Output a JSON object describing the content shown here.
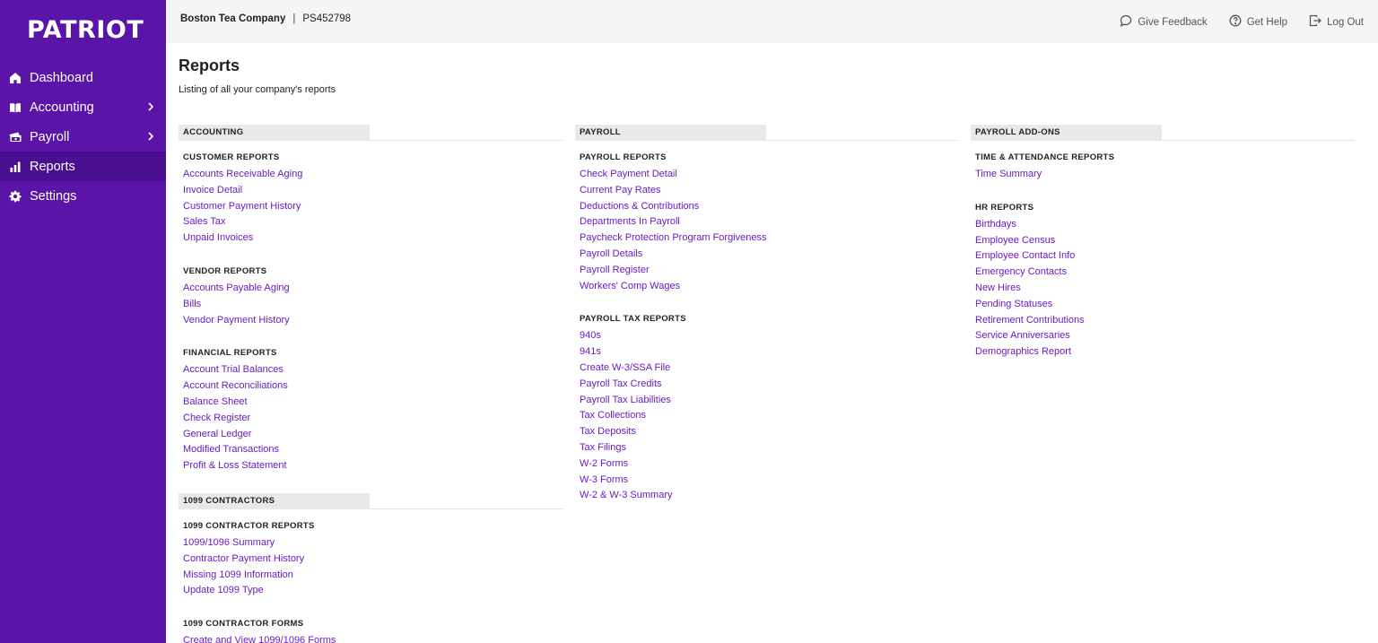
{
  "brand": {
    "logo": "PATRIOT",
    "accent": "#5a14a8",
    "link_color": "#6a1bc2"
  },
  "sidebar": {
    "items": [
      {
        "label": "Dashboard",
        "icon": "home-icon",
        "has_submenu": false,
        "active": false
      },
      {
        "label": "Accounting",
        "icon": "book-icon",
        "has_submenu": true,
        "active": false
      },
      {
        "label": "Payroll",
        "icon": "money-icon",
        "has_submenu": true,
        "active": false
      },
      {
        "label": "Reports",
        "icon": "bar-chart-icon",
        "has_submenu": false,
        "active": true
      },
      {
        "label": "Settings",
        "icon": "gear-icon",
        "has_submenu": false,
        "active": false
      }
    ]
  },
  "header": {
    "company": "Boston Tea Company",
    "separator": "|",
    "account_id": "PS452798",
    "actions": [
      {
        "label": "Give Feedback",
        "icon": "chat-bubble-icon"
      },
      {
        "label": "Get Help",
        "icon": "help-circle-icon"
      },
      {
        "label": "Log Out",
        "icon": "logout-icon"
      }
    ]
  },
  "main": {
    "title": "Reports",
    "subtitle": "Listing of all your company's reports",
    "columns": [
      {
        "sections": [
          {
            "header": "ACCOUNTING",
            "groups": [
              {
                "title": "CUSTOMER REPORTS",
                "links": [
                  "Accounts Receivable Aging",
                  "Invoice Detail",
                  "Customer Payment History",
                  "Sales Tax",
                  "Unpaid Invoices"
                ]
              },
              {
                "title": "VENDOR REPORTS",
                "links": [
                  "Accounts Payable Aging",
                  "Bills",
                  "Vendor Payment History"
                ]
              },
              {
                "title": "FINANCIAL REPORTS",
                "links": [
                  "Account Trial Balances",
                  "Account Reconciliations",
                  "Balance Sheet",
                  "Check Register",
                  "General Ledger",
                  "Modified Transactions",
                  "Profit & Loss Statement"
                ]
              }
            ]
          },
          {
            "header": "1099 CONTRACTORS",
            "groups": [
              {
                "title": "1099 CONTRACTOR REPORTS",
                "links": [
                  "1099/1096 Summary",
                  "Contractor Payment History",
                  "Missing 1099 Information",
                  "Update 1099 Type"
                ]
              },
              {
                "title": "1099 CONTRACTOR FORMS",
                "links": [
                  "Create and View 1099/1096 Forms"
                ]
              }
            ]
          }
        ]
      },
      {
        "sections": [
          {
            "header": "PAYROLL",
            "groups": [
              {
                "title": "PAYROLL REPORTS",
                "links": [
                  "Check Payment Detail",
                  "Current Pay Rates",
                  "Deductions & Contributions",
                  "Departments In Payroll",
                  "Paycheck Protection Program Forgiveness",
                  "Payroll Details",
                  "Payroll Register",
                  "Workers' Comp Wages"
                ]
              },
              {
                "title": "PAYROLL TAX REPORTS",
                "links": [
                  "940s",
                  "941s",
                  "Create W-3/SSA File",
                  "Payroll Tax Credits",
                  "Payroll Tax Liabilities",
                  "Tax Collections",
                  "Tax Deposits",
                  "Tax Filings",
                  "W-2 Forms",
                  "W-3 Forms",
                  "W-2 & W-3 Summary"
                ]
              }
            ]
          }
        ]
      },
      {
        "sections": [
          {
            "header": "PAYROLL ADD-ONS",
            "groups": [
              {
                "title": "TIME & ATTENDANCE REPORTS",
                "links": [
                  "Time Summary"
                ]
              },
              {
                "title": "HR REPORTS",
                "links": [
                  "Birthdays",
                  "Employee Census",
                  "Employee Contact Info",
                  "Emergency Contacts",
                  "New Hires",
                  "Pending Statuses",
                  "Retirement Contributions",
                  "Service Anniversaries",
                  "Demographics Report"
                ]
              }
            ]
          }
        ]
      }
    ]
  }
}
